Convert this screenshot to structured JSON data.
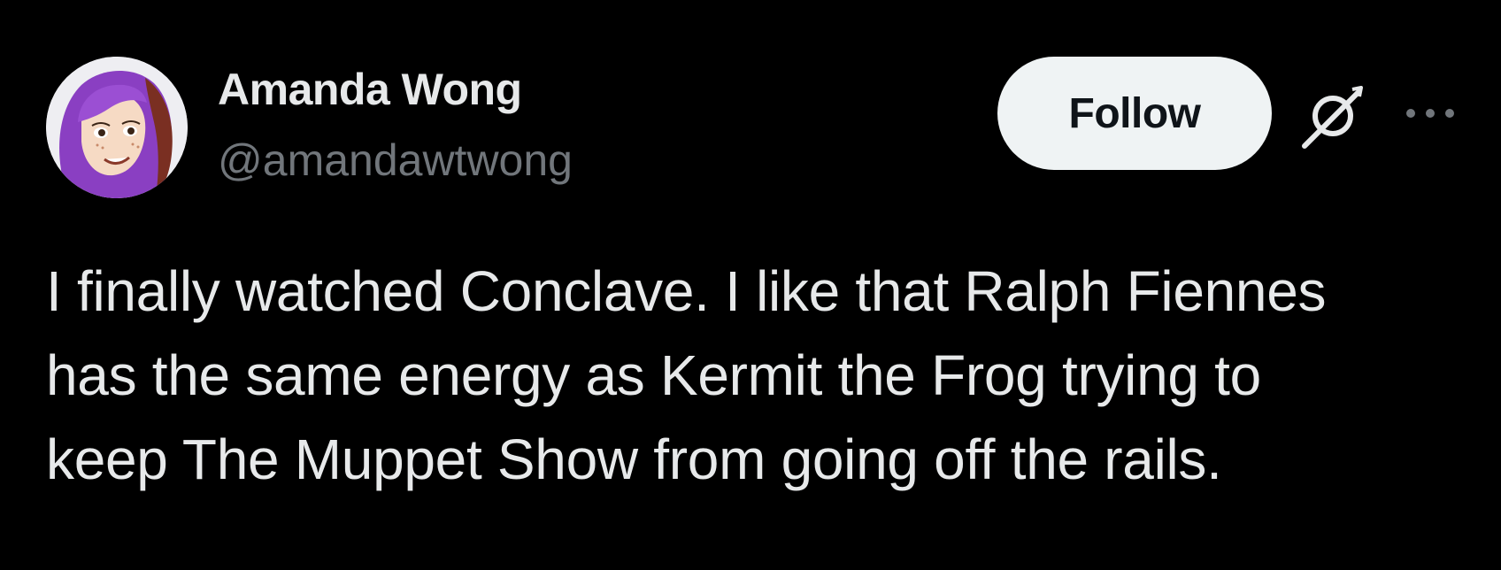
{
  "author": {
    "display_name": "Amanda Wong",
    "handle": "@amandawtwong",
    "avatar_icon": "cartoon-woman-purple-hair-avatar"
  },
  "actions": {
    "follow_label": "Follow",
    "grok_icon": "grok-icon",
    "more_icon": "more-options-icon"
  },
  "tweet": {
    "lines": [
      "I finally watched Conclave. I like that Ralph Fiennes",
      "has the same energy as Kermit the Frog trying to",
      "keep The Muppet Show from going off the rails."
    ]
  },
  "colors": {
    "background": "#000000",
    "primary_text": "#e7e9ea",
    "secondary_text": "#71767b",
    "follow_button_bg": "#eff3f4",
    "follow_button_text": "#0f1419",
    "avatar_hair": "#8a3fc2"
  }
}
